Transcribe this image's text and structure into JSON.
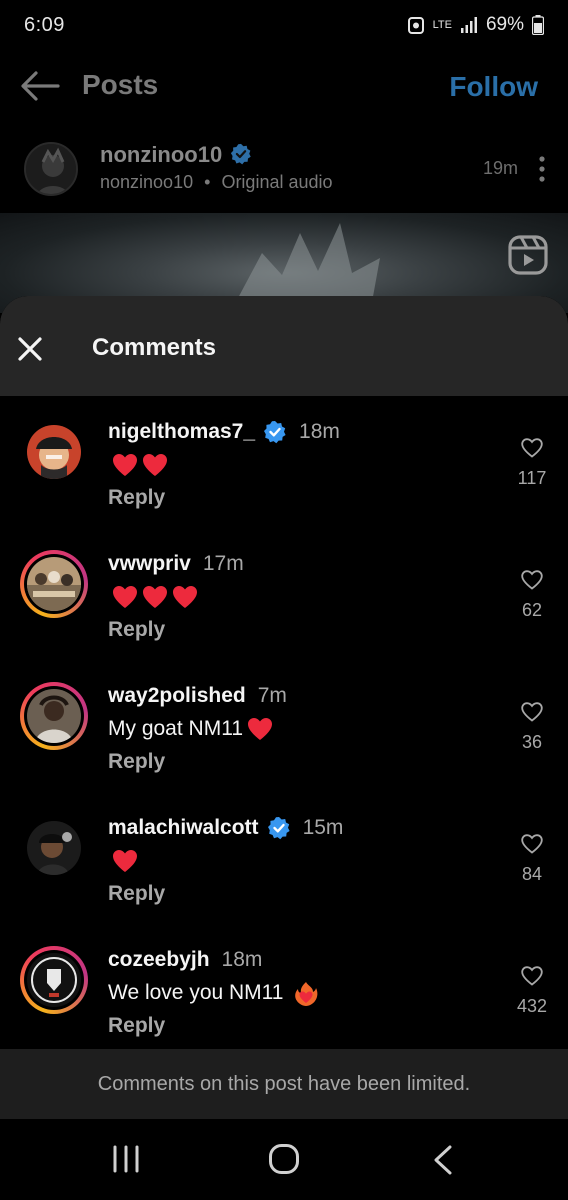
{
  "status_bar": {
    "time": "6:09",
    "network": "LTE",
    "battery": "69%"
  },
  "header": {
    "title": "Posts",
    "follow_label": "Follow"
  },
  "post": {
    "username": "nonzinoo10",
    "subtitle_user": "nonzinoo10",
    "separator": "•",
    "audio": "Original audio",
    "time": "19m"
  },
  "sheet": {
    "title": "Comments"
  },
  "comments": [
    {
      "username": "nigelthomas7_",
      "verified": true,
      "time": "18m",
      "text": "",
      "hearts": 2,
      "reply": "Reply",
      "likes": "117",
      "story_ring": false,
      "avatar_icon": "anime-character-avatar"
    },
    {
      "username": "vwwpriv",
      "verified": false,
      "time": "17m",
      "text": "",
      "hearts": 3,
      "reply": "Reply",
      "likes": "62",
      "story_ring": true,
      "avatar_icon": "group-photo-avatar"
    },
    {
      "username": "way2polished",
      "verified": false,
      "time": "7m",
      "text": "My goat NM11",
      "hearts": 1,
      "reply": "Reply",
      "likes": "36",
      "story_ring": true,
      "avatar_icon": "person-photo-avatar"
    },
    {
      "username": "malachiwalcott",
      "verified": true,
      "time": "15m",
      "text": "",
      "hearts": 1,
      "reply": "Reply",
      "likes": "84",
      "story_ring": false,
      "avatar_icon": "cartoon-avatar"
    },
    {
      "username": "cozeebyjh",
      "verified": false,
      "time": "18m",
      "text": "We love you NM11",
      "hearts": 0,
      "fire_heart": true,
      "reply": "Reply",
      "likes": "432",
      "story_ring": true,
      "avatar_icon": "brand-logo-avatar"
    }
  ],
  "footer": {
    "limited_notice": "Comments on this post have been limited."
  },
  "colors": {
    "follow": "#2a6fa8",
    "verified": "#3897f0",
    "heart": "#ed2a3d",
    "sheet_header": "#262626"
  }
}
